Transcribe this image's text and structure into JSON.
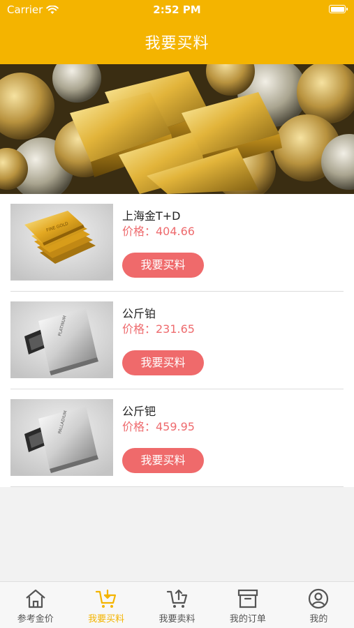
{
  "status_bar": {
    "carrier": "Carrier",
    "time": "2:52 PM"
  },
  "nav": {
    "title": "我要买料"
  },
  "products": [
    {
      "name": "上海金T+D",
      "price_label": "价格：404.66",
      "button_label": "我要买料",
      "metal": "gold"
    },
    {
      "name": "公斤铂",
      "price_label": "价格：231.65",
      "button_label": "我要买料",
      "metal": "platinum"
    },
    {
      "name": "公斤钯",
      "price_label": "价格：459.95",
      "button_label": "我要买料",
      "metal": "palladium"
    }
  ],
  "tabs": [
    {
      "label": "参考金价",
      "icon": "home-icon",
      "active": false
    },
    {
      "label": "我要买料",
      "icon": "cart-icon",
      "active": true
    },
    {
      "label": "我要卖料",
      "icon": "cart-upload-icon",
      "active": false
    },
    {
      "label": "我的订单",
      "icon": "box-icon",
      "active": false
    },
    {
      "label": "我的",
      "icon": "user-icon",
      "active": false
    }
  ],
  "colors": {
    "accent": "#f4b400",
    "button": "#ef6a6b",
    "price": "#ee6b6e"
  }
}
